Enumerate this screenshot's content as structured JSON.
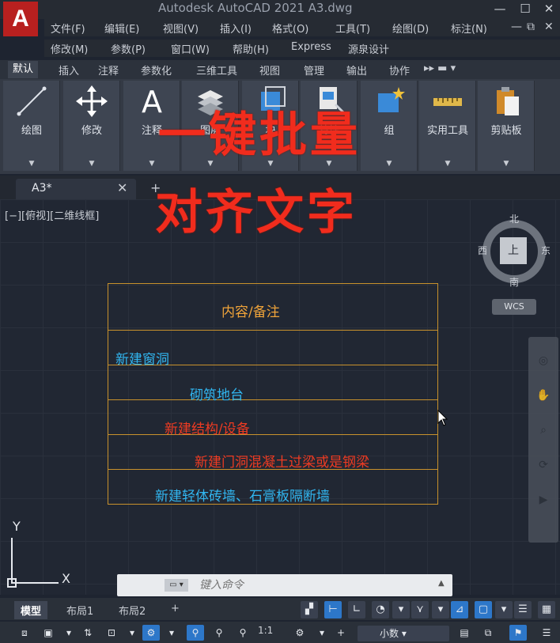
{
  "app": {
    "logo_letter": "A",
    "title": "Autodesk AutoCAD 2021    A3.dwg",
    "window_controls": [
      "—",
      "☐",
      "✕"
    ],
    "doc_controls": [
      "—",
      "⧉",
      "✕"
    ]
  },
  "menu": {
    "row1": [
      "文件(F)",
      "编辑(E)",
      "视图(V)",
      "插入(I)",
      "格式(O)",
      "工具(T)",
      "绘图(D)",
      "标注(N)"
    ],
    "row2": [
      "修改(M)",
      "参数(P)",
      "窗口(W)",
      "帮助(H)",
      "Express",
      "源泉设计"
    ]
  },
  "ribbon_tabs": [
    "默认",
    "插入",
    "注释",
    "参数化",
    "三维工具",
    "视图",
    "管理",
    "输出",
    "协作"
  ],
  "ribbon_panels": [
    "绘图",
    "修改",
    "注释",
    "图层",
    "块",
    "特性",
    "组",
    "实用工具",
    "剪贴板"
  ],
  "doc_tab": {
    "label": "A3*",
    "close": "✕",
    "add": "+"
  },
  "viewport_label": "[−][俯视][二维线框]",
  "overlay": {
    "line1": "一键批量",
    "line2": "对齐文字"
  },
  "viewcube": {
    "north": "北",
    "south": "南",
    "east": "东",
    "west": "西",
    "face": "上",
    "wcs": "WCS"
  },
  "table": {
    "header": "内容/备注",
    "rows": [
      "新建窗洞",
      "砌筑地台",
      "新建结构/设备",
      "新建门洞混凝土过梁或是钢梁",
      "新建轻体砖墙、石膏板隔断墙"
    ]
  },
  "ucs": {
    "x": "X",
    "y": "Y"
  },
  "command": {
    "placeholder": "键入命令"
  },
  "layout_tabs": [
    "模型",
    "布局1",
    "布局2",
    "+"
  ],
  "status": {
    "scale": "1:1",
    "units": "小数"
  },
  "colors": {
    "overlay_red": "#f12c1d",
    "table_border": "#c8912c",
    "text_cyan": "#31b6f0",
    "text_red": "#ef3b22",
    "text_header": "#f0a43a",
    "status_blue": "#2d77c9"
  }
}
